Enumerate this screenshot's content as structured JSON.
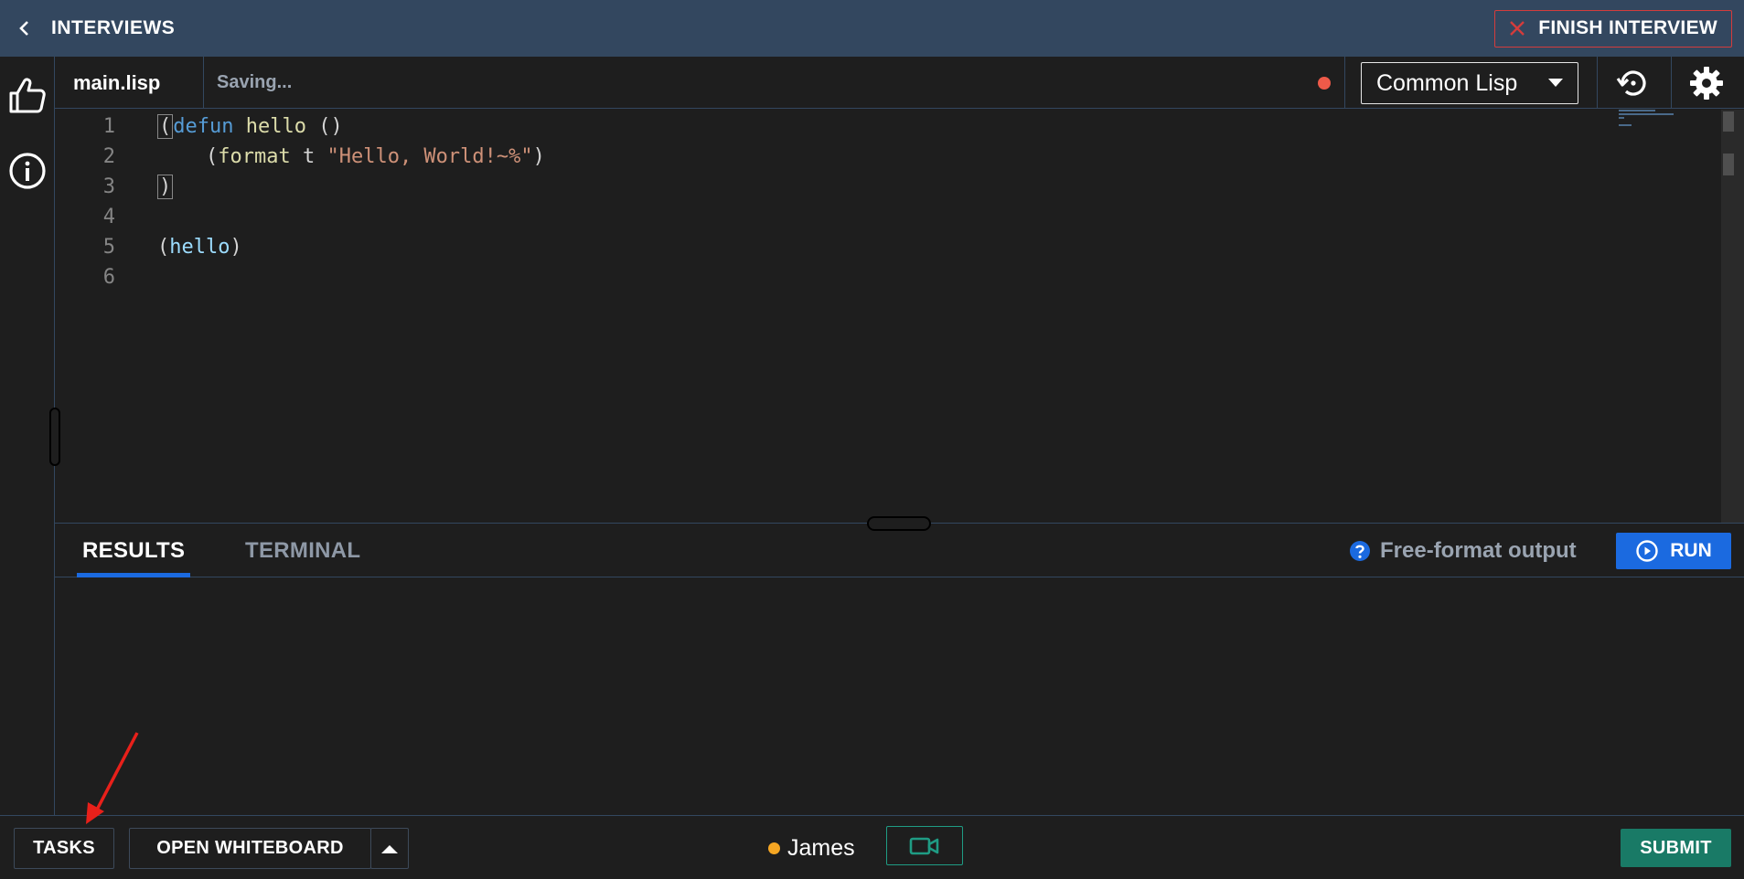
{
  "topbar": {
    "back_label": "INTERVIEWS",
    "finish_label": "FINISH INTERVIEW",
    "accent_color": "#d43c3c"
  },
  "leftrail": {
    "icons": [
      "thumbs-up-icon",
      "info-icon"
    ]
  },
  "editor": {
    "file_name": "main.lisp",
    "save_status": "Saving...",
    "unsaved_indicator_color": "#ee5a49",
    "language": "Common Lisp",
    "line_numbers": [
      "1",
      "2",
      "3",
      "4",
      "5",
      "6"
    ],
    "code": {
      "l1_open": "(",
      "l1_kw": "defun",
      "l1_fn": " hello",
      "l1_rest": " ()",
      "l2_indent": "    (",
      "l2_fn": "format",
      "l2_mid": " t ",
      "l2_str": "\"Hello, World!~%\"",
      "l2_close": ")",
      "l3": ")",
      "l5_open": "(",
      "l5_id": "hello",
      "l5_close": ")"
    }
  },
  "results": {
    "tabs": [
      {
        "label": "RESULTS",
        "active": true
      },
      {
        "label": "TERMINAL",
        "active": false
      }
    ],
    "output_mode": "Free-format output",
    "run_label": "RUN",
    "run_color": "#1b6ae0"
  },
  "bottombar": {
    "tasks_label": "TASKS",
    "whiteboard_label": "OPEN WHITEBOARD",
    "user_name": "James",
    "user_status_color": "#f5a623",
    "submit_label": "SUBMIT",
    "submit_color": "#197a66"
  }
}
